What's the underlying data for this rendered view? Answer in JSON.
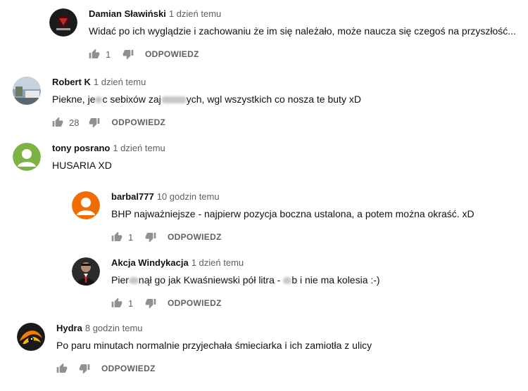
{
  "comments": [
    {
      "author": "Damian Sławiński",
      "time": "1 dzień temu",
      "text": "Widać po ich wyglądzie i zachowaniu że im się należało, może  naucza się czegoś na przyszłość...",
      "likes": "1",
      "reply": "ODPOWIEDZ",
      "avatar": "dark-logo-avatar"
    },
    {
      "author": "Robert K",
      "time": "1 dzień temu",
      "text_parts": [
        "Piekne, je",
        "c sebixów zaj",
        "ych, wgl wszystkich co nosza te buty xD"
      ],
      "likes": "28",
      "reply": "ODPOWIEDZ",
      "avatar": "street-photo-avatar"
    },
    {
      "author": "tony posrano",
      "time": "1 dzień temu",
      "text": "HUSARIA XD",
      "avatar": "green-default-avatar",
      "color": "#7cb342"
    },
    {
      "author": "barbal777",
      "time": "10 godzin temu",
      "text": "BHP najważniejsze - najpierw pozycja boczna ustalona, a potem można okraść. xD",
      "likes": "1",
      "reply": "ODPOWIEDZ",
      "avatar": "orange-default-avatar",
      "color": "#ef6c00"
    },
    {
      "author": "Akcja Windykacja",
      "time": "1 dzień temu",
      "text_parts": [
        "Pier",
        "nął go jak Kwaśniewski pół litra - ",
        "b i nie ma kolesia :-)"
      ],
      "likes": "1",
      "reply": "ODPOWIEDZ",
      "avatar": "suit-man-avatar"
    },
    {
      "author": "Hydra",
      "time": "8 godzin temu",
      "text": "Po paru minutach normalnie przyjechała śmieciarka i ich zamiotła z ulicy",
      "likes": "",
      "reply": "ODPOWIEDZ",
      "avatar": "fire-eye-avatar"
    }
  ],
  "icons": {
    "like": "thumb-up-icon",
    "dislike": "thumb-down-icon"
  },
  "colors": {
    "meta": "#606060",
    "text": "#111111"
  }
}
